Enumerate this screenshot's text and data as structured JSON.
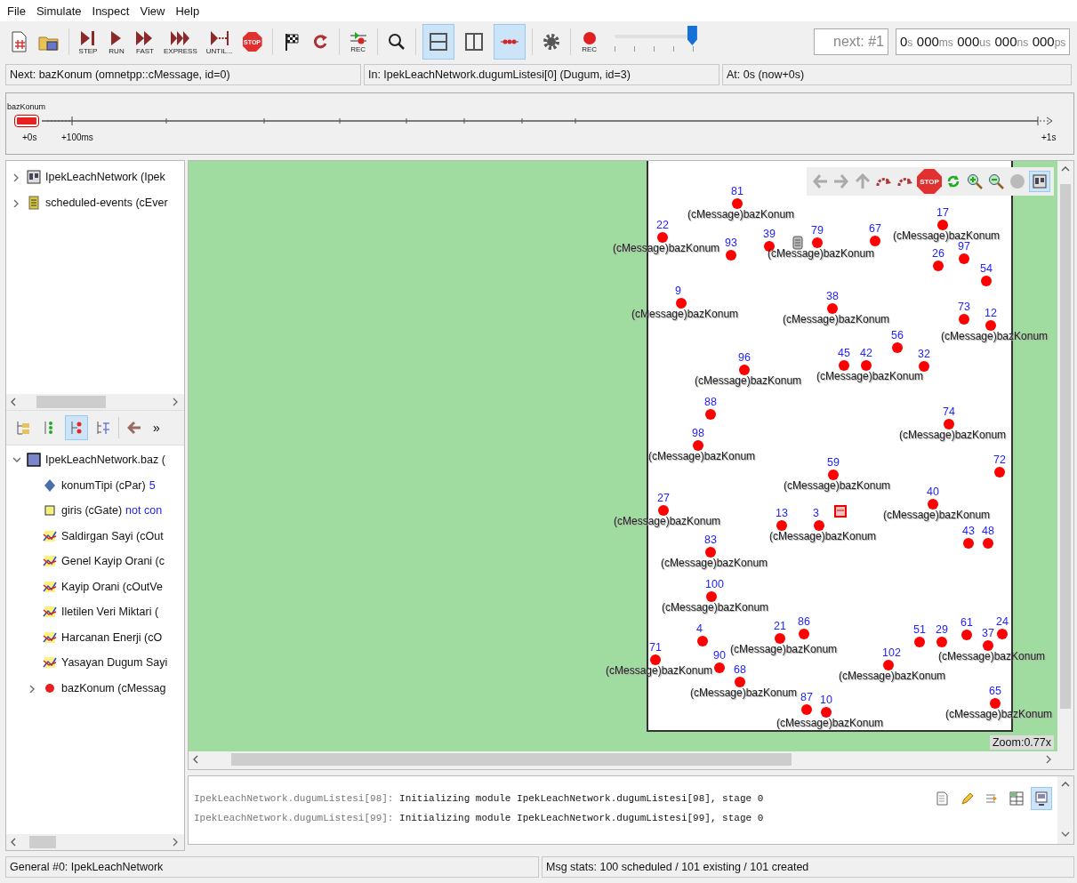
{
  "menu": [
    "File",
    "Simulate",
    "Inspect",
    "View",
    "Help"
  ],
  "toolbar": {
    "run_buttons": [
      {
        "kind": "step",
        "label": "STEP"
      },
      {
        "kind": "run",
        "label": "RUN"
      },
      {
        "kind": "fast",
        "label": "FAST"
      },
      {
        "kind": "express",
        "label": "EXPRESS"
      },
      {
        "kind": "until",
        "label": "UNTIL..."
      },
      {
        "kind": "stop",
        "label": "STOP"
      }
    ],
    "record_label": "REC",
    "view_toggles": [
      {
        "selected": true
      },
      {
        "selected": false
      },
      {
        "selected": true
      }
    ],
    "capture_label": "REC",
    "speed": {
      "level": 0.96
    },
    "next_event": "next: #1",
    "sim_time": [
      {
        "value": "0",
        "unit": "s"
      },
      {
        "value": "000",
        "unit": "ms"
      },
      {
        "value": "000",
        "unit": "us"
      },
      {
        "value": "000",
        "unit": "ns"
      },
      {
        "value": "000",
        "unit": "ps"
      }
    ]
  },
  "status_row": [
    "Next: bazKonum (omnetpp::cMessage, id=0)",
    "In: IpekLeachNetwork.dugumListesi[0] (Dugum, id=3)",
    "At: 0s (now+0s)"
  ],
  "timeline": {
    "message": "bazKonum",
    "ticks": [
      "+0s",
      "+100ms",
      "+1s"
    ]
  },
  "object_tree": [
    {
      "kind": "network",
      "label": "IpekLeachNetwork (Ipek",
      "expanded": false
    },
    {
      "kind": "queue",
      "label": "scheduled-events (cEver",
      "expanded": false
    }
  ],
  "inspector_toolbar": {
    "modes": [
      {
        "selected": false
      },
      {
        "selected": false
      },
      {
        "selected": true
      },
      {
        "selected": false
      }
    ],
    "more_label": "»"
  },
  "inspector_tree": {
    "kind": "module",
    "label": "IpekLeachNetwork.baz (",
    "expanded": true,
    "children": [
      {
        "kind": "par",
        "label": "konumTipi (cPar)",
        "value": "5"
      },
      {
        "kind": "gate",
        "label": "giris (cGate)",
        "value": "not con"
      },
      {
        "kind": "vector",
        "label": "Saldirgan Sayi (cOut"
      },
      {
        "kind": "vector",
        "label": "Genel Kayip Orani (c"
      },
      {
        "kind": "vector",
        "label": "Kayip Orani (cOutVe"
      },
      {
        "kind": "vector",
        "label": "Iletilen Veri Miktari ("
      },
      {
        "kind": "vector",
        "label": "Harcanan Enerji (cO"
      },
      {
        "kind": "vector",
        "label": "Yasayan Dugum Sayi"
      },
      {
        "kind": "message",
        "label": "bazKonum (cMessag",
        "expanded": false
      }
    ]
  },
  "network": {
    "stop_label": "STOP",
    "layout_toggle": {
      "selected": true
    },
    "zoom": "Zoom:0.77x",
    "nodes": [
      {
        "number": "81",
        "message": "(cMessage)bazKonum"
      },
      {
        "number": "17",
        "message": "(cMessage)bazKonum"
      },
      {
        "number": "22",
        "message": "(cMessage)bazKonum"
      },
      {
        "number": "93"
      },
      {
        "number": "39"
      },
      {
        "number": "79",
        "message": "(cMessage)bazKonum"
      },
      {
        "number": "67"
      },
      {
        "number": "97"
      },
      {
        "number": "26"
      },
      {
        "number": "54"
      },
      {
        "number": "9",
        "message": "(cMessage)bazKonum"
      },
      {
        "number": "38",
        "message": "(cMessage)bazKonum"
      },
      {
        "number": "56"
      },
      {
        "number": "73"
      },
      {
        "number": "12",
        "message": "(cMessage)bazKonum"
      },
      {
        "number": "45"
      },
      {
        "number": "42",
        "message": "(cMessage)bazKonum"
      },
      {
        "number": "32"
      },
      {
        "number": "96",
        "message": "(cMessage)bazKonum"
      },
      {
        "number": "88"
      },
      {
        "number": "74",
        "message": "(cMessage)bazKonum"
      },
      {
        "number": "98",
        "message": "(cMessage)bazKonum"
      },
      {
        "number": "59",
        "message": "(cMessage)bazKonum"
      },
      {
        "number": "72"
      },
      {
        "number": "40",
        "message": "(cMessage)bazKonum"
      },
      {
        "number": "27",
        "message": "(cMessage)bazKonum"
      },
      {
        "number": "13"
      },
      {
        "number": "3",
        "message": "(cMessage)bazKonum"
      },
      {
        "number": "43"
      },
      {
        "number": "48"
      },
      {
        "number": "83",
        "message": "(cMessage)bazKonum"
      },
      {
        "number": "100",
        "message": "(cMessage)bazKonum"
      },
      {
        "number": "4"
      },
      {
        "number": "21",
        "message": "(cMessage)bazKonum"
      },
      {
        "number": "86"
      },
      {
        "number": "51"
      },
      {
        "number": "29"
      },
      {
        "number": "61"
      },
      {
        "number": "37",
        "message": "(cMessage)bazKonum"
      },
      {
        "number": "24"
      },
      {
        "number": "71",
        "message": "(cMessage)bazKonum"
      },
      {
        "number": "90"
      },
      {
        "number": "68",
        "message": "(cMessage)bazKonum"
      },
      {
        "number": "102",
        "message": "(cMessage)bazKonum"
      },
      {
        "number": "87"
      },
      {
        "number": "10",
        "message": "(cMessage)bazKonum"
      },
      {
        "number": "65",
        "message": "(cMessage)bazKonum"
      }
    ]
  },
  "log": {
    "lines": [
      {
        "source": "IpekLeachNetwork.dugumListesi[98]:",
        "text": "Initializing module IpekLeachNetwork.dugumListesi[98], stage 0"
      },
      {
        "source": "IpekLeachNetwork.dugumListesi[99]:",
        "text": "Initializing module IpekLeachNetwork.dugumListesi[99], stage 0"
      }
    ],
    "modes": [
      {
        "selected": false
      },
      {
        "selected": false
      },
      {
        "selected": false
      },
      {
        "selected": false
      },
      {
        "selected": true
      }
    ]
  },
  "status_bar": [
    "General #0: IpekLeachNetwork",
    "Msg stats: 100 scheduled / 101 existing / 101 created"
  ]
}
